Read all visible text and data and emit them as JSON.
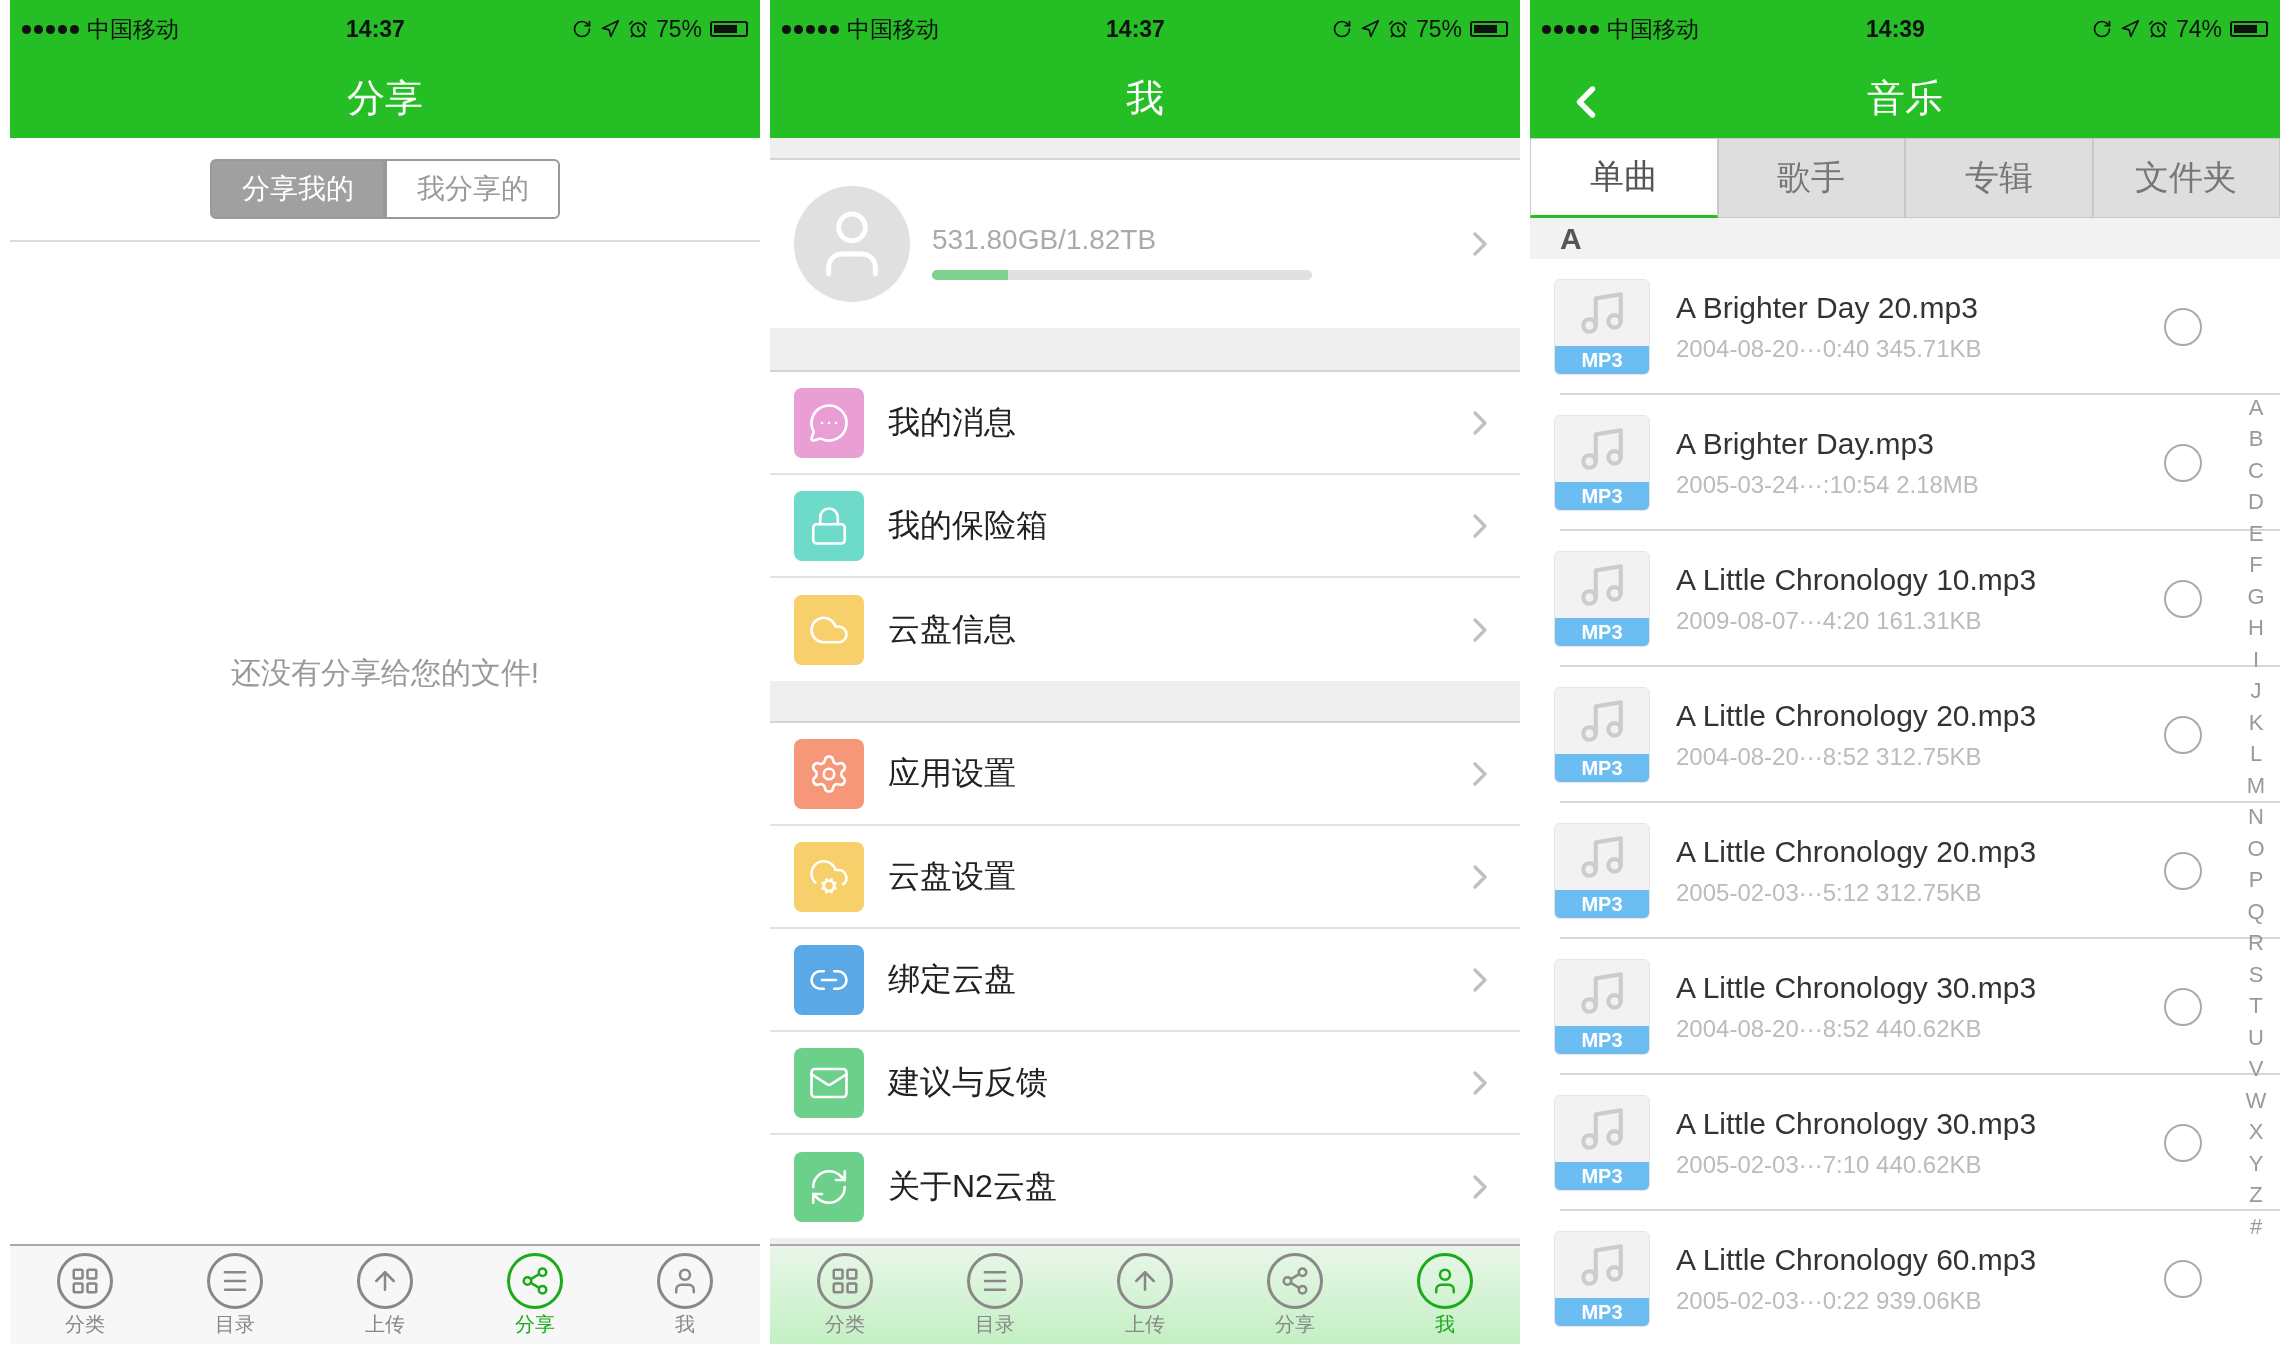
{
  "share_screen": {
    "status_bar": {
      "carrier": "中国移动",
      "time": "14:37",
      "battery": "75%"
    },
    "title": "分享",
    "segments": [
      {
        "label": "分享我的",
        "selected": true
      },
      {
        "label": "我分享的",
        "selected": false
      }
    ],
    "empty_message": "还没有分享给您的文件!",
    "tab_bar": [
      {
        "label": "分类",
        "selected": false
      },
      {
        "label": "目录",
        "selected": false
      },
      {
        "label": "上传",
        "selected": false
      },
      {
        "label": "分享",
        "selected": true
      },
      {
        "label": "我",
        "selected": false
      }
    ]
  },
  "me_screen": {
    "status_bar": {
      "carrier": "中国移动",
      "time": "14:37",
      "battery": "75%"
    },
    "title": "我",
    "storage": {
      "text": "531.80GB/1.82TB",
      "level": 0.2
    },
    "menu_groups": [
      [
        {
          "label": "我的消息",
          "color": "#e99fd4"
        },
        {
          "label": "我的保险箱",
          "color": "#6edac9"
        },
        {
          "label": "云盘信息",
          "color": "#f7cf6b"
        }
      ],
      [
        {
          "label": "应用设置",
          "color": "#f7977a"
        },
        {
          "label": "云盘设置",
          "color": "#f7cf6b"
        },
        {
          "label": "绑定云盘",
          "color": "#5aa9e6"
        },
        {
          "label": "建议与反馈",
          "color": "#6ccf8a"
        },
        {
          "label": "关于N2云盘",
          "color": "#6ccf8a"
        }
      ]
    ],
    "tab_bar": [
      {
        "label": "分类",
        "selected": false
      },
      {
        "label": "目录",
        "selected": false
      },
      {
        "label": "上传",
        "selected": false
      },
      {
        "label": "分享",
        "selected": false
      },
      {
        "label": "我",
        "selected": true
      }
    ]
  },
  "music_screen": {
    "status_bar": {
      "carrier": "中国移动",
      "time": "14:39",
      "battery": "74%"
    },
    "title": "音乐",
    "tabs": [
      {
        "label": "单曲",
        "selected": true
      },
      {
        "label": "歌手",
        "selected": false
      },
      {
        "label": "专辑",
        "selected": false
      },
      {
        "label": "文件夹",
        "selected": false
      }
    ],
    "section": "A",
    "songs": [
      {
        "title": "A Brighter Day 20.mp3",
        "meta": "2004-08-20···0:40 345.71KB",
        "badge": "MP3",
        "selected": false
      },
      {
        "title": "A Brighter Day.mp3",
        "meta": "2005-03-24···:10:54 2.18MB",
        "badge": "MP3",
        "selected": false
      },
      {
        "title": "A Little Chronology 10.mp3",
        "meta": "2009-08-07···4:20 161.31KB",
        "badge": "MP3",
        "selected": false
      },
      {
        "title": "A Little Chronology 20.mp3",
        "meta": "2004-08-20···8:52 312.75KB",
        "badge": "MP3",
        "selected": false
      },
      {
        "title": "A Little Chronology 20.mp3",
        "meta": "2005-02-03···5:12 312.75KB",
        "badge": "MP3",
        "selected": false
      },
      {
        "title": "A Little Chronology 30.mp3",
        "meta": "2004-08-20···8:52 440.62KB",
        "badge": "MP3",
        "selected": false
      },
      {
        "title": "A Little Chronology 30.mp3",
        "meta": "2005-02-03···7:10 440.62KB",
        "badge": "MP3",
        "selected": false
      },
      {
        "title": "A Little Chronology 60.mp3",
        "meta": "2005-02-03···0:22 939.06KB",
        "badge": "MP3",
        "selected": false
      }
    ],
    "index": [
      "A",
      "B",
      "C",
      "D",
      "E",
      "F",
      "G",
      "H",
      "I",
      "J",
      "K",
      "L",
      "M",
      "N",
      "O",
      "P",
      "Q",
      "R",
      "S",
      "T",
      "U",
      "V",
      "W",
      "X",
      "Y",
      "Z",
      "#"
    ]
  }
}
